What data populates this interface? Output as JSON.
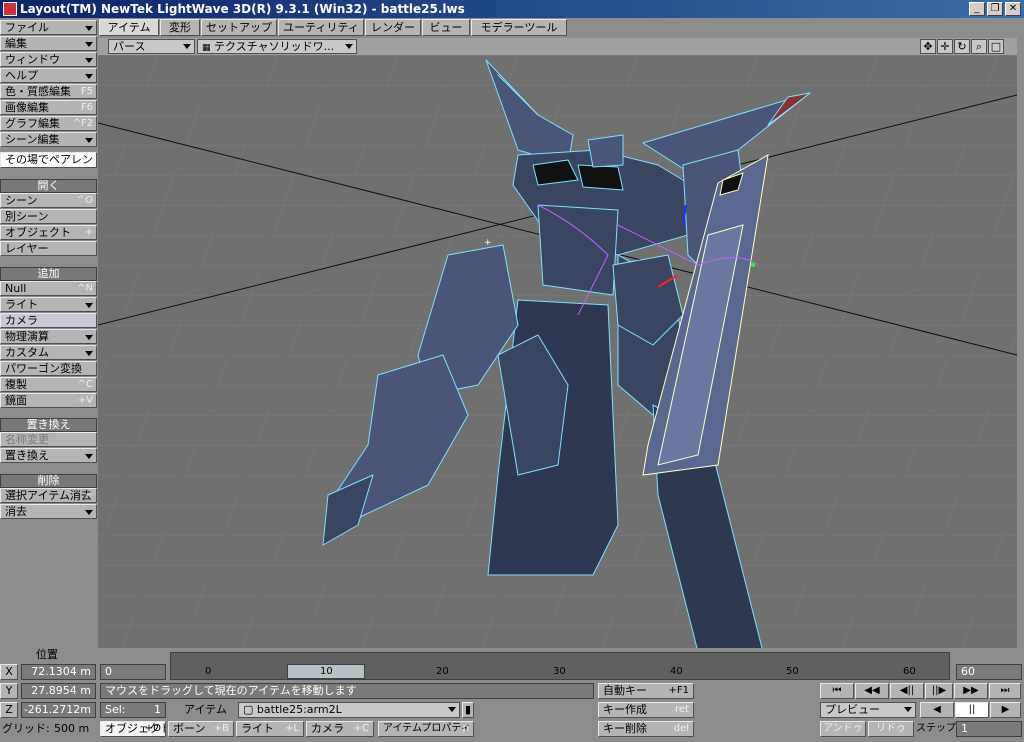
{
  "window": {
    "title": "Layout(TM) NewTek LightWave 3D(R) 9.3.1 (Win32) - battle25.lws",
    "minimize": "_",
    "maximize": "❐",
    "close": "✕"
  },
  "tabs": [
    "アイテム",
    "変形",
    "セットアップ",
    "ユーティリティ",
    "レンダー",
    "ビュー",
    "モデラーツール"
  ],
  "menu": {
    "file": "ファイル",
    "edit": "編集",
    "window": "ウィンドウ",
    "help": "ヘルプ",
    "surface": {
      "label": "色・質感編集",
      "shortcut": "F5"
    },
    "image": {
      "label": "画像編集",
      "shortcut": "F6"
    },
    "graph": {
      "label": "グラフ編集",
      "shortcut": "^F2"
    },
    "scene_edit": "シーン編集",
    "parent_in_place": "その場でペアレント"
  },
  "open_section": {
    "header": "開く",
    "scene": {
      "label": "シーン",
      "shortcut": "^O"
    },
    "other_scene": "別シーン",
    "object": {
      "label": "オブジェクト",
      "shortcut": "+"
    },
    "layer": "レイヤー"
  },
  "add_section": {
    "header": "追加",
    "null": {
      "label": "Null",
      "shortcut": "^N"
    },
    "light": "ライト",
    "camera": "カメラ",
    "dynamics": "物理演算",
    "custom": "カスタム",
    "poly_convert": "パワーゴン変換",
    "clone": {
      "label": "複製",
      "shortcut": "^C"
    },
    "mirror": {
      "label": "鏡面",
      "shortcut": "+V"
    }
  },
  "replace_section": {
    "header": "置き換え",
    "rename": "名称変更",
    "replace": "置き換え"
  },
  "delete_section": {
    "header": "削除",
    "clear_selected": {
      "label": "選択アイテム消去",
      "shortcut": "−"
    },
    "clear": "消去"
  },
  "viewport": {
    "view_mode": "パース",
    "render_style": "テクスチャソリッドワ..."
  },
  "position": {
    "header": "位置",
    "x_label": "X",
    "x_value": "72.1304 m",
    "y_label": "Y",
    "y_value": "27.8954 m",
    "z_label": "Z",
    "z_value": "-261.2712m",
    "grid_label": "グリッド:",
    "grid_value": "500 m"
  },
  "timeline": {
    "start": "0",
    "end": "60",
    "ticks": [
      "0",
      "10",
      "20",
      "30",
      "40",
      "50",
      "60"
    ],
    "current_frame": "10"
  },
  "status": {
    "message": "マウスをドラッグして現在のアイテムを移動します",
    "sel_label": "Sel:",
    "sel_value": "1",
    "item_label": "アイテム",
    "item_value": "battle25:arm2L"
  },
  "modes": {
    "objects": "オブジェクト",
    "objects_sc": "+O",
    "bones": "ボーン",
    "bones_sc": "+B",
    "lights": "ライト",
    "lights_sc": "+L",
    "cameras": "カメラ",
    "cameras_sc": "+C",
    "properties": "アイテムプロパティ",
    "properties_sc": "p"
  },
  "keys": {
    "auto_key": "自動キー",
    "auto_key_sc": "+F1",
    "create_key": "キー作成",
    "create_key_sc": "ret",
    "delete_key": "キー削除",
    "delete_key_sc": "del"
  },
  "playback": {
    "first": "⏮",
    "prev_key": "◀◀",
    "prev_frame": "◀||",
    "next_frame": "||▶",
    "next_key": "▶▶",
    "last": "⏭",
    "preview": "プレビュー",
    "play_back": "◀",
    "pause": "||",
    "play": "▶",
    "undo": "アンドゥ",
    "redo": "リドゥ",
    "step_label": "ステップ",
    "step_value": "1"
  },
  "colors": {
    "wire": "#7fe0ff",
    "mesh_dark": "#3a4560",
    "mesh_light": "#5a6890",
    "selected": "#ffffc8",
    "bone": "#c060ff"
  }
}
